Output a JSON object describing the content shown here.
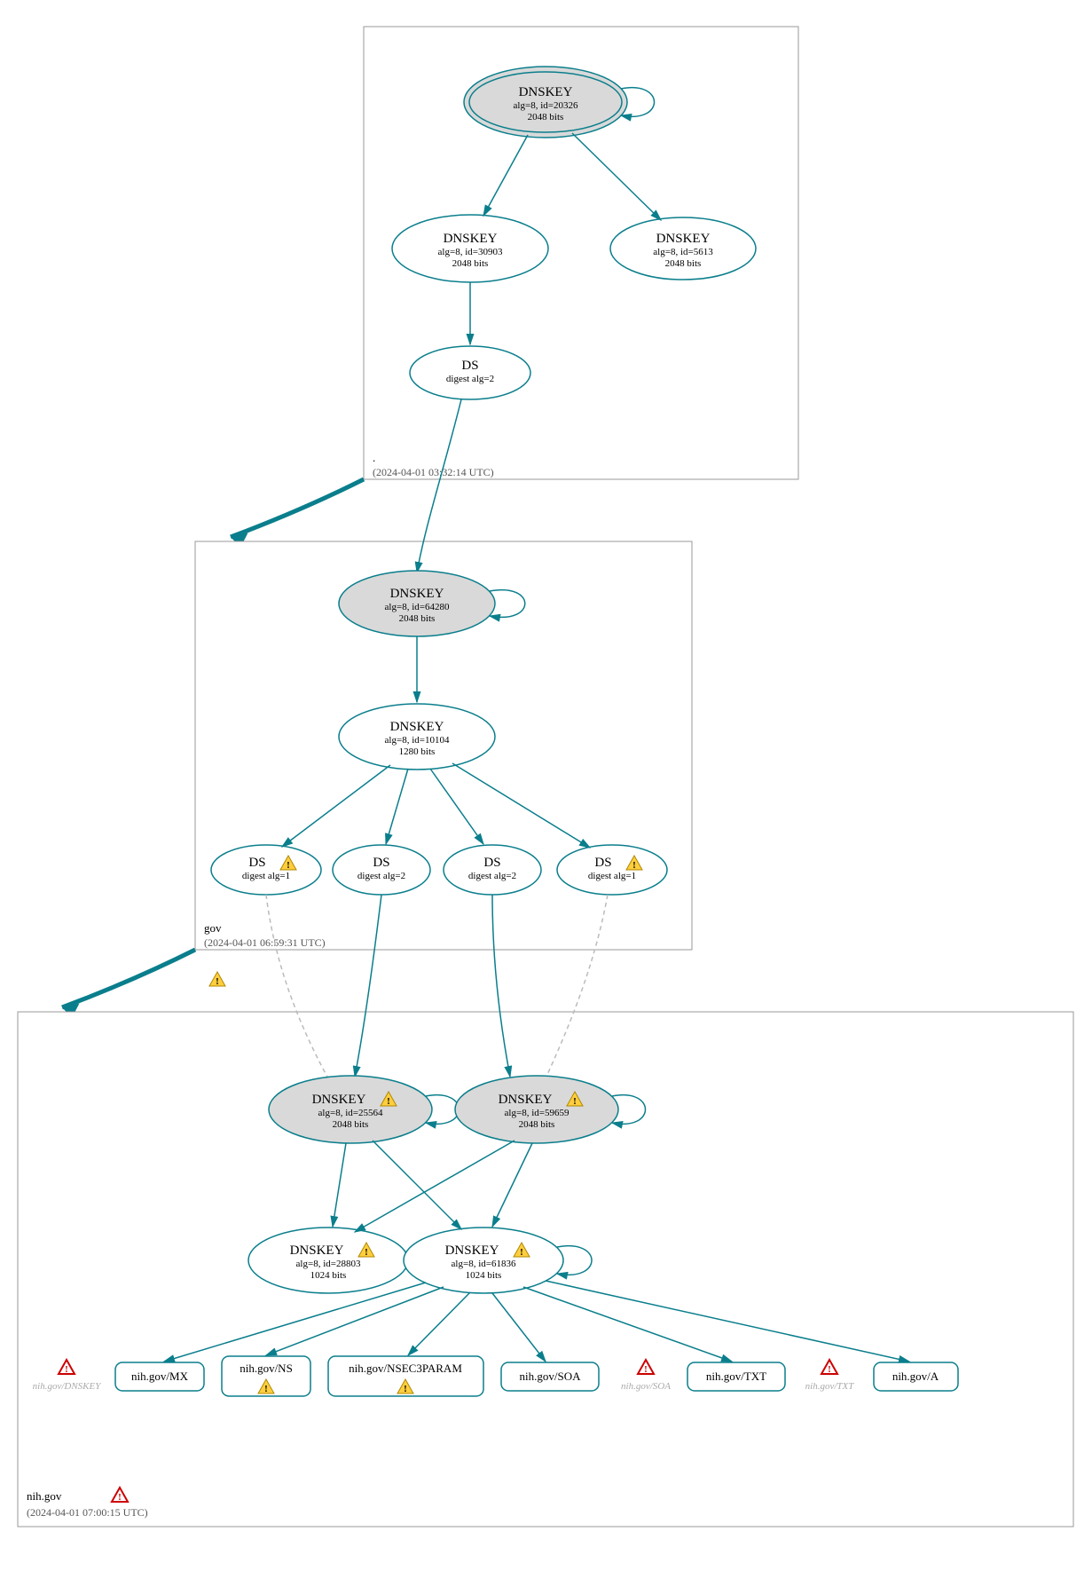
{
  "zones": {
    "root": {
      "label": ".",
      "time": "(2024-04-01 03:32:14 UTC)"
    },
    "gov": {
      "label": "gov",
      "time": "(2024-04-01 06:59:31 UTC)"
    },
    "nih": {
      "label": "nih.gov",
      "time": "(2024-04-01 07:00:15 UTC)"
    }
  },
  "nodes": {
    "rootKSK": {
      "title": "DNSKEY",
      "l1": "alg=8, id=20326",
      "l2": "2048 bits"
    },
    "rootZSK1": {
      "title": "DNSKEY",
      "l1": "alg=8, id=30903",
      "l2": "2048 bits"
    },
    "rootZSK2": {
      "title": "DNSKEY",
      "l1": "alg=8, id=5613",
      "l2": "2048 bits"
    },
    "rootDS": {
      "title": "DS",
      "l1": "digest alg=2"
    },
    "govKSK": {
      "title": "DNSKEY",
      "l1": "alg=8, id=64280",
      "l2": "2048 bits"
    },
    "govZSK": {
      "title": "DNSKEY",
      "l1": "alg=8, id=10104",
      "l2": "1280 bits"
    },
    "govDS1": {
      "title": "DS",
      "l1": "digest alg=1"
    },
    "govDS2": {
      "title": "DS",
      "l1": "digest alg=2"
    },
    "govDS3": {
      "title": "DS",
      "l1": "digest alg=2"
    },
    "govDS4": {
      "title": "DS",
      "l1": "digest alg=1"
    },
    "nihKSK1": {
      "title": "DNSKEY",
      "l1": "alg=8, id=25564",
      "l2": "2048 bits"
    },
    "nihKSK2": {
      "title": "DNSKEY",
      "l1": "alg=8, id=59659",
      "l2": "2048 bits"
    },
    "nihZSK1": {
      "title": "DNSKEY",
      "l1": "alg=8, id=28803",
      "l2": "1024 bits"
    },
    "nihZSK2": {
      "title": "DNSKEY",
      "l1": "alg=8, id=61836",
      "l2": "1024 bits"
    }
  },
  "records": {
    "mx": "nih.gov/MX",
    "ns": "nih.gov/NS",
    "nsec3": "nih.gov/NSEC3PARAM",
    "soa": "nih.gov/SOA",
    "txt": "nih.gov/TXT",
    "a": "nih.gov/A"
  },
  "errors": {
    "dnskey": "nih.gov/DNSKEY",
    "soa": "nih.gov/SOA",
    "txt": "nih.gov/TXT"
  }
}
